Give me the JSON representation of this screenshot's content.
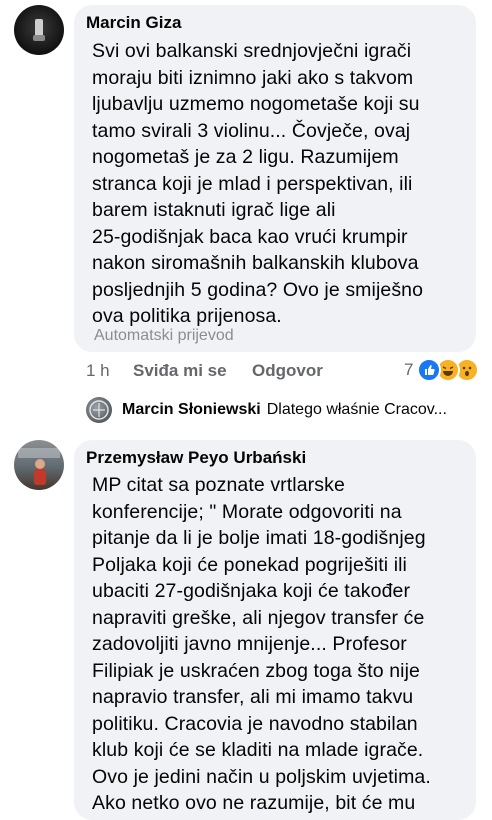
{
  "comment1": {
    "author": "Marcin Giza",
    "lines": [
      "Svi ovi balkanski srednjovječni igrači",
      "moraju biti iznimno jaki ako s takvom",
      "ljubavlju uzmemo nogometaše koji su",
      "tamo svirali 3 violinu... Čovječe, ovaj",
      "nogometaš je za 2 ligu. Razumijem",
      "stranca koji je mlad i perspektivan, ili",
      "barem istaknuti igrač lige ali",
      "25-godišnjak baca kao vrući krumpir",
      "nakon siromašnih balkanskih klubova",
      "posljednjih 5 godina? Ovo je smiješno",
      "ova politika prijenosa."
    ],
    "translated_label": "Automatski prijevod",
    "time": "1 h",
    "like_label": "Sviđa mi se",
    "reply_label": "Odgovor",
    "reaction_count": "7",
    "reactions": [
      "like-icon",
      "haha-icon",
      "wow-icon"
    ],
    "colors": {
      "like": "#1877f2",
      "haha": "#f7b125",
      "wow": "#f7b125"
    }
  },
  "reply": {
    "author": "Marcin Słoniewski",
    "preview": "Dlatego właśnie Cracov..."
  },
  "comment2": {
    "author": "Przemysław Peyo Urbański",
    "lines": [
      "MP citat sa poznate vrtlarske",
      "konferencije; \" Morate odgovoriti na",
      "pitanje da li je bolje imati 18-godišnjeg",
      "Poljaka koji će ponekad pogriješiti ili",
      "ubaciti 27-godišnjaka koji će također",
      "napraviti greške, ali njegov transfer će",
      "zadovoljiti javno mnijenje... Profesor",
      "Filipiak je uskraćen zbog toga što nije",
      "napravio transfer, ali mi imamo takvu",
      "politiku. Cracovia je navodno stabilan",
      "klub koji će se kladiti na mlade igrače.",
      "Ovo je jedini način u poljskim uvjetima.",
      "Ako netko ovo ne razumije, bit će mu"
    ]
  }
}
